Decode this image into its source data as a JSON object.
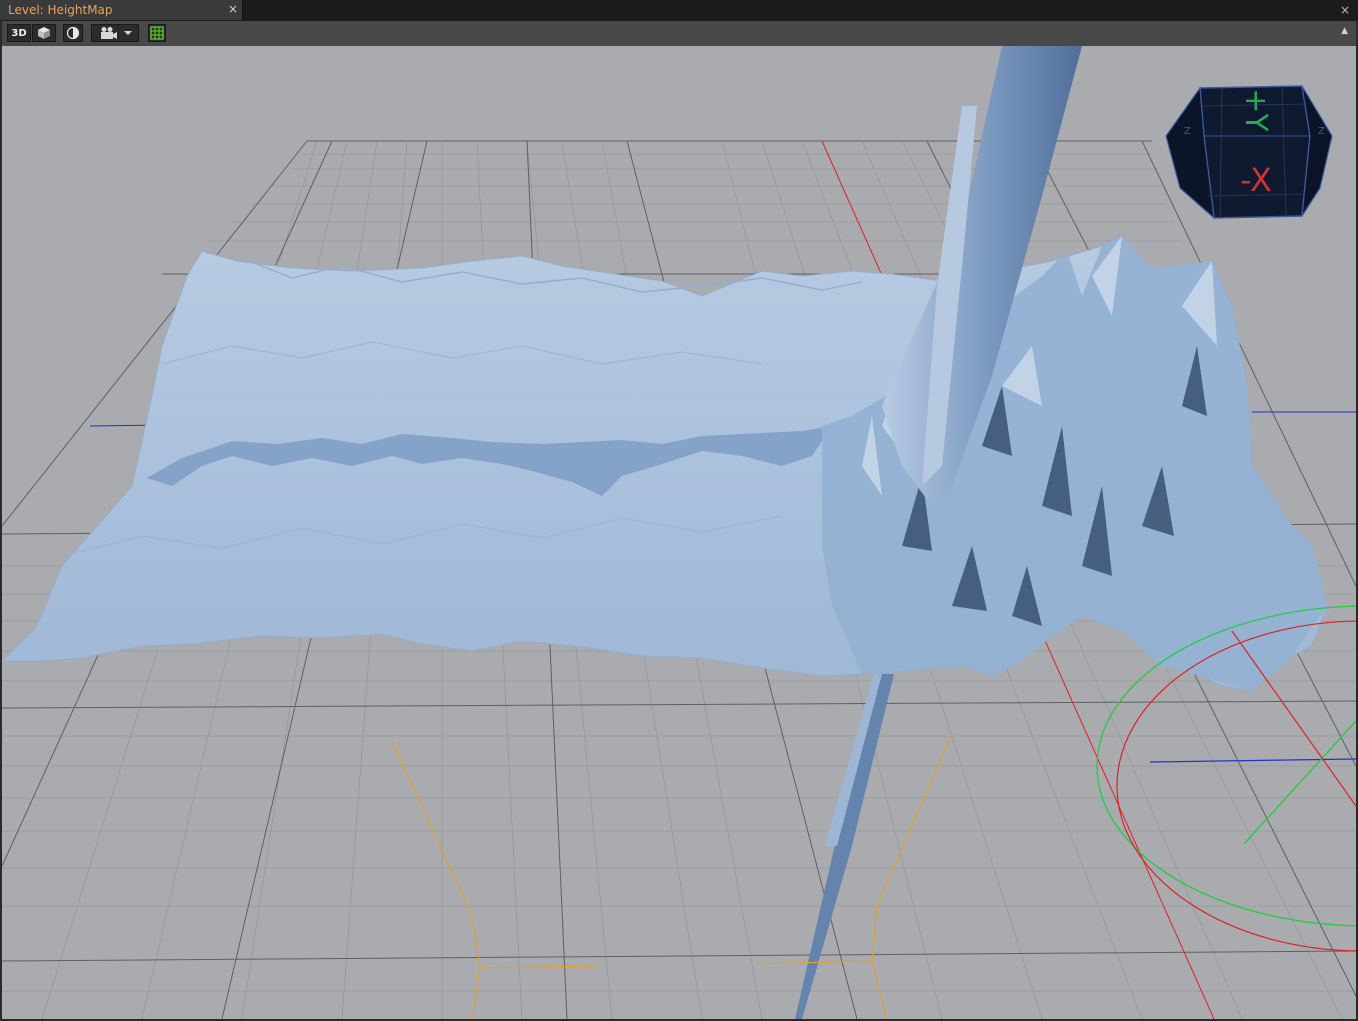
{
  "window": {
    "tab_title": "Level: HeightMap",
    "tab_close_glyph": "×",
    "close_glyph": "×"
  },
  "toolbar": {
    "view_mode_label": "3D",
    "items": [
      {
        "name": "view-mode-3d-button",
        "icon": "3d-text"
      },
      {
        "name": "perspective-cube-icon",
        "icon": "cube-icon"
      },
      {
        "name": "shading-toggle-button",
        "icon": "half-sphere-icon"
      },
      {
        "name": "camera-dropdown-button",
        "icon": "camera-icon"
      },
      {
        "name": "grid-toggle-button",
        "icon": "grid-icon"
      }
    ],
    "collapse_glyph": "▲"
  },
  "viewport": {
    "background_color": "#a9abaf",
    "terrain_color": "#a9c0db",
    "grid_color": "#6e7074",
    "axis_x_color": "#dd2222",
    "axis_y_color": "#22cc44",
    "axis_z_color": "#2233cc",
    "camera_frustum_color": "#e0a030"
  },
  "view_cube": {
    "top_label": "+Y",
    "front_label": "-X",
    "side_label": "Z",
    "top_label_color": "#22aa55",
    "front_label_color": "#cc3333"
  }
}
